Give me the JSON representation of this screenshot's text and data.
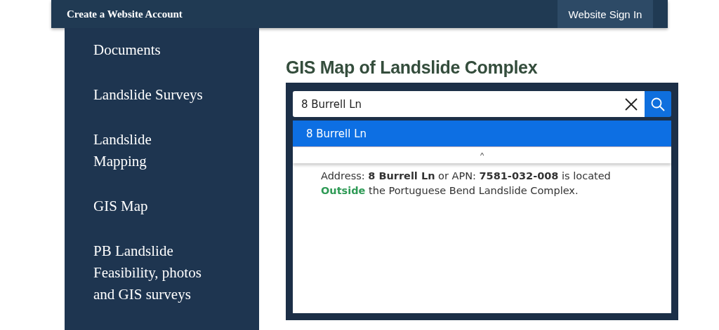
{
  "header": {
    "title": "Create a Website Account",
    "sign_in": "Website Sign In"
  },
  "sidebar": {
    "items": [
      {
        "label": "Documents"
      },
      {
        "label": "Landslide Surveys"
      },
      {
        "label": "Landslide Mapping"
      },
      {
        "label": "GIS Map"
      },
      {
        "label": "PB Landslide Feasibility, photos and GIS surveys"
      }
    ]
  },
  "main": {
    "title": "GIS Map of Landslide Complex",
    "search": {
      "value": "8 Burrell Ln"
    },
    "suggestions": [
      {
        "label": "8 Burrell Ln",
        "selected": true
      }
    ],
    "collapse": "^",
    "result": {
      "text": "Address: **8 Burrell Ln** or APN: **7581-032-008** is located",
      "status": "Outside",
      "rest": "the Portuguese Bend Landslide Complex."
    }
  }
}
